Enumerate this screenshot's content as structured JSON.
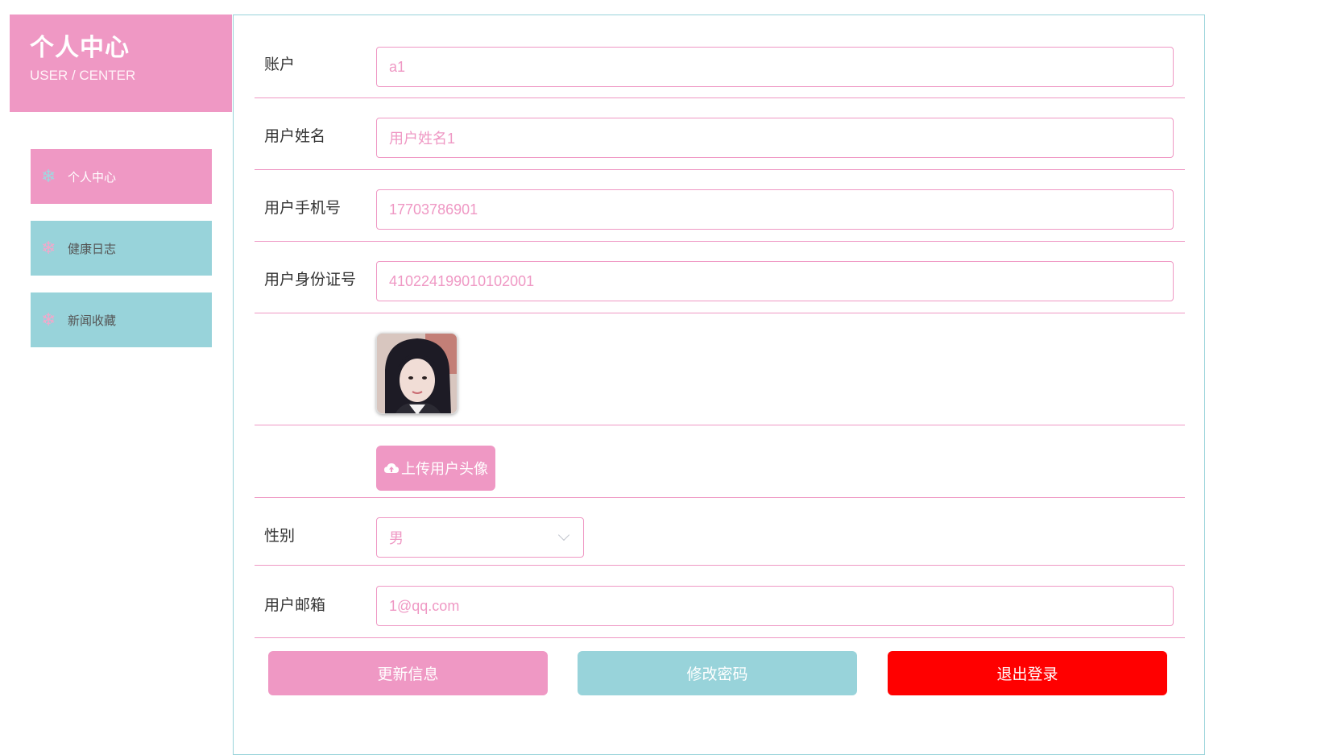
{
  "sidebar": {
    "title": "个人中心",
    "subtitle": "USER / CENTER",
    "items": [
      {
        "label": "个人中心",
        "icon": "snowflake-icon"
      },
      {
        "label": "健康日志",
        "icon": "snowflake-icon"
      },
      {
        "label": "新闻收藏",
        "icon": "snowflake-icon"
      }
    ]
  },
  "form": {
    "account": {
      "label": "账户",
      "value": "a1"
    },
    "name": {
      "label": "用户姓名",
      "value": "用户姓名1"
    },
    "phone": {
      "label": "用户手机号",
      "value": "17703786901"
    },
    "idcard": {
      "label": "用户身份证号",
      "value": "410224199010102001"
    },
    "upload_label": "上传用户头像",
    "gender": {
      "label": "性别",
      "value": "男"
    },
    "email": {
      "label": "用户邮箱",
      "value": "1@qq.com"
    }
  },
  "actions": {
    "update": "更新信息",
    "change_password": "修改密码",
    "logout": "退出登录"
  },
  "colors": {
    "primary_pink": "#ef98c4",
    "secondary_teal": "#98d3da",
    "danger_red": "#ff0000"
  }
}
